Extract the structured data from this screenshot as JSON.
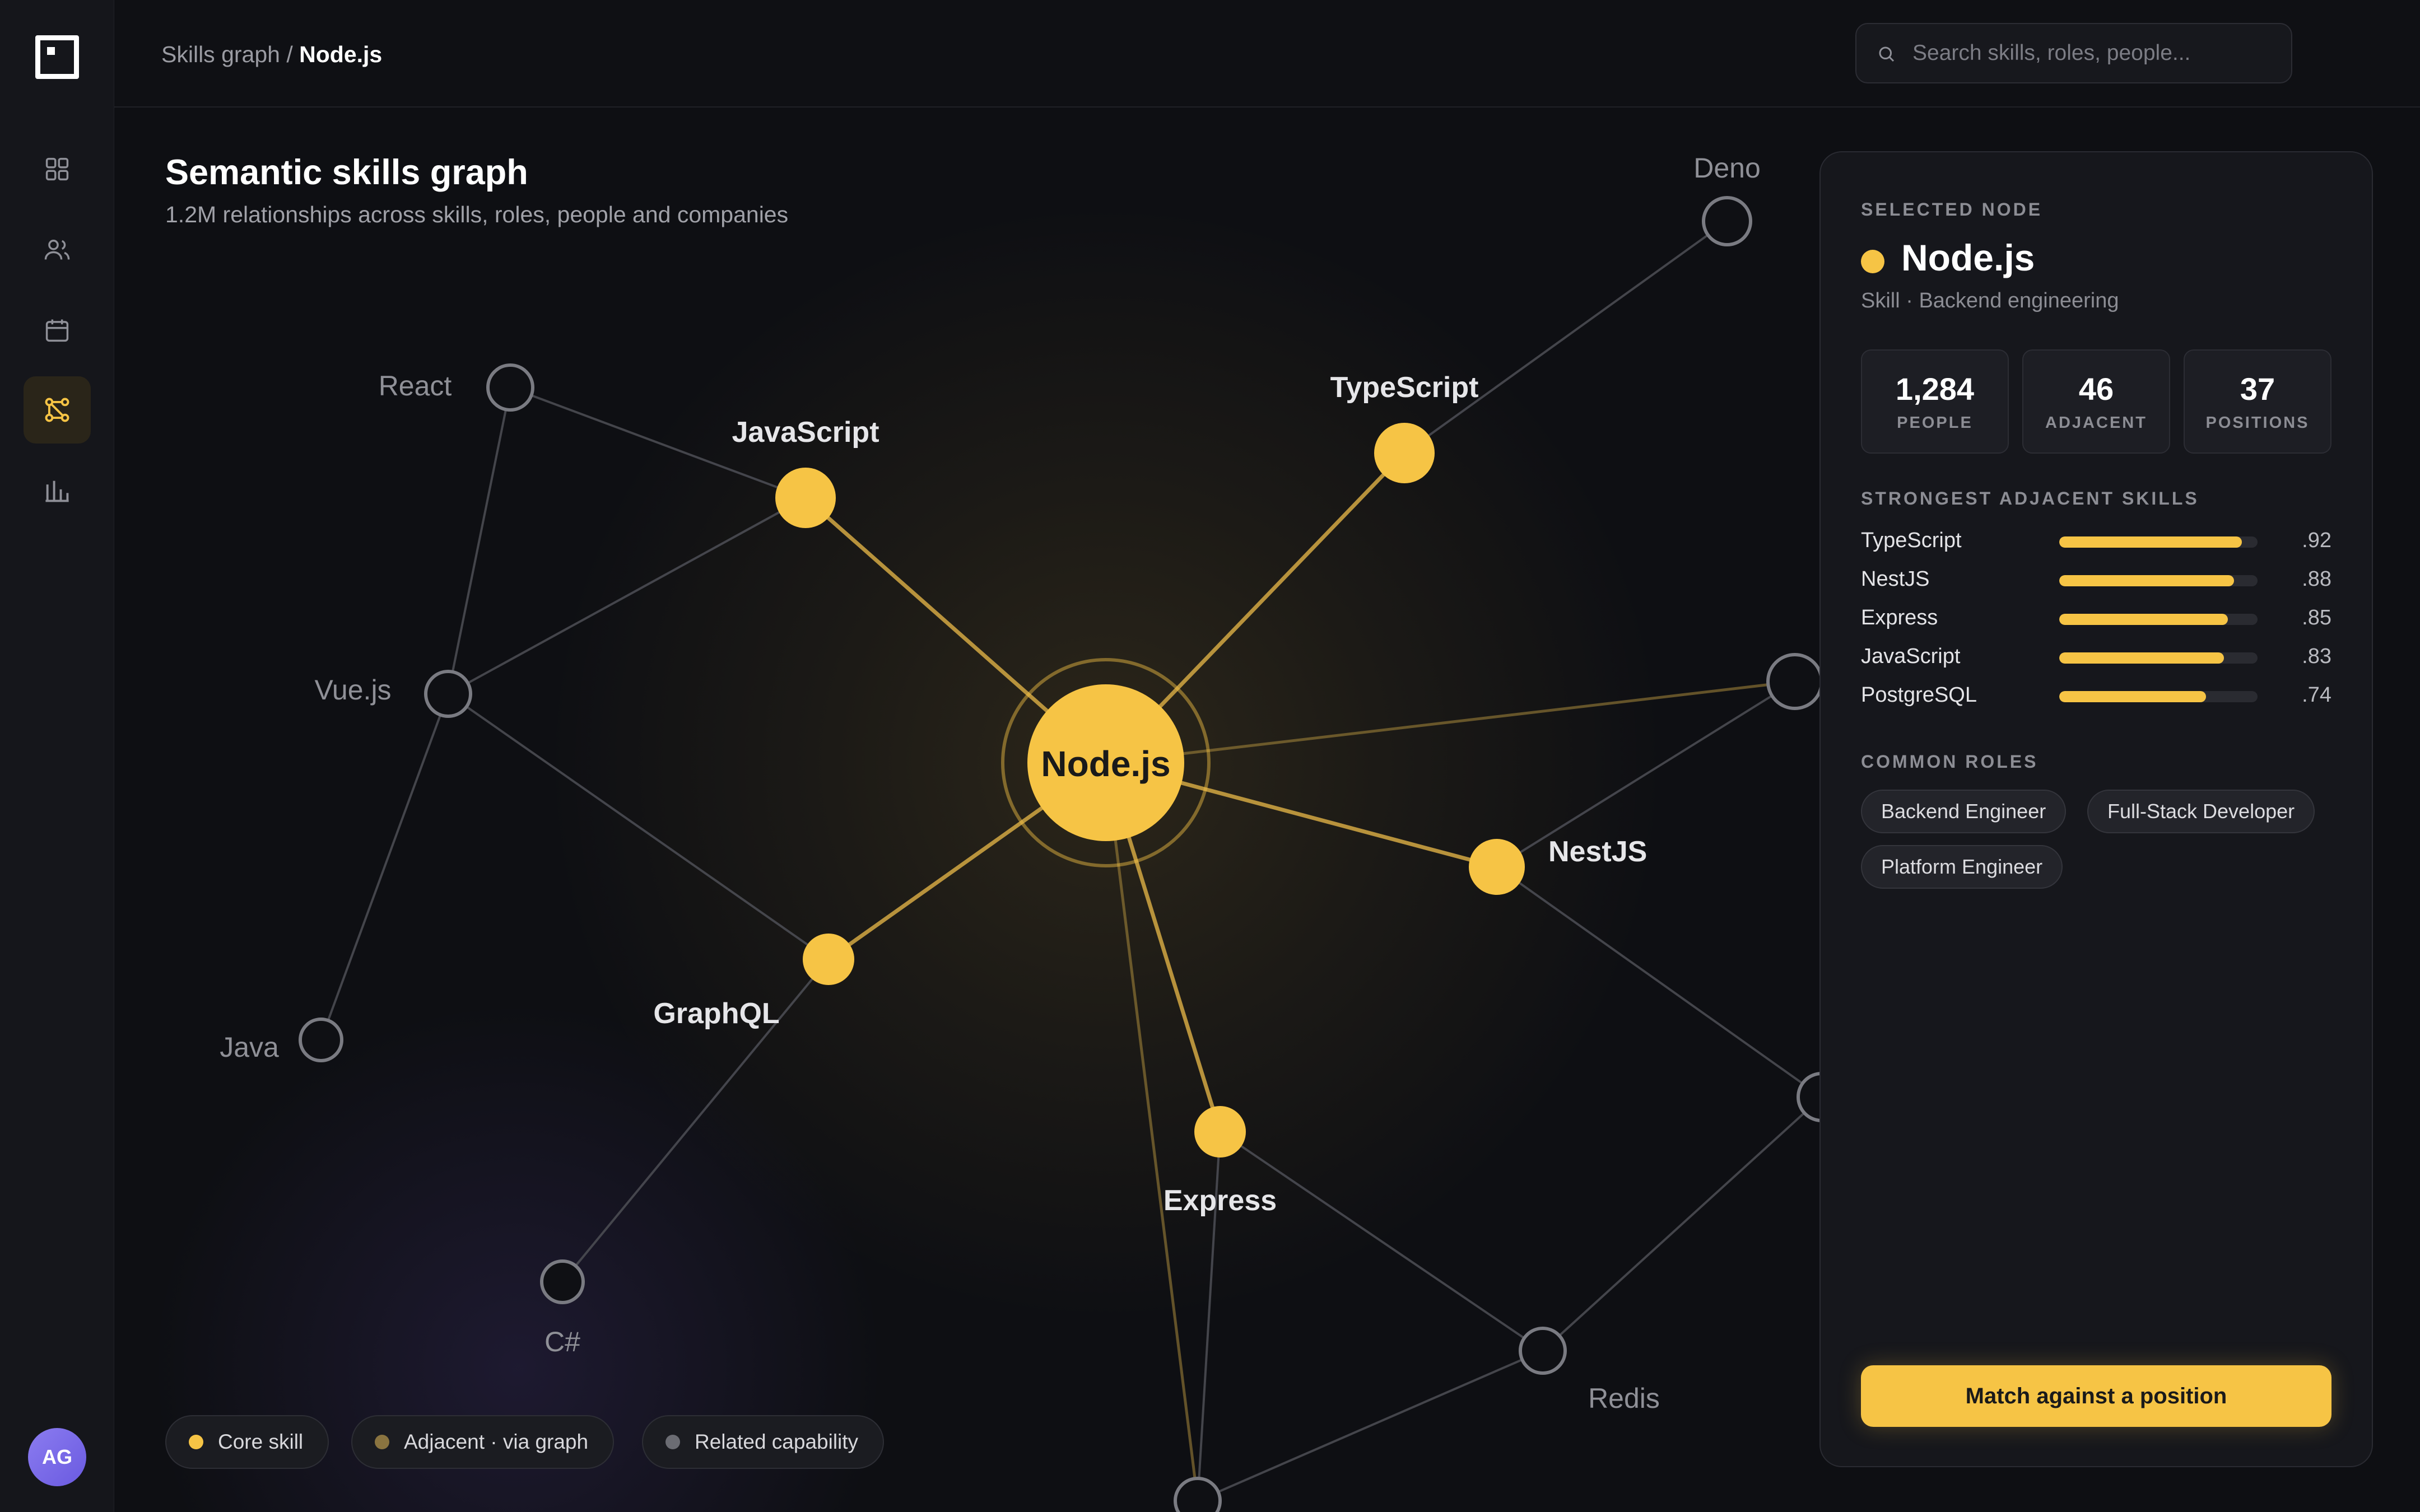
{
  "app": {
    "avatar_initials": "AG"
  },
  "breadcrumb": {
    "parent": "Skills graph",
    "separator": " / ",
    "current": "Node.js"
  },
  "search": {
    "placeholder": "Search skills, roles, people..."
  },
  "nav": {
    "items": [
      {
        "id": "dashboard",
        "icon": "grid-icon",
        "active": false
      },
      {
        "id": "people",
        "icon": "users-icon",
        "active": false
      },
      {
        "id": "calendar",
        "icon": "calendar-icon",
        "active": false
      },
      {
        "id": "graph",
        "icon": "graph-icon",
        "active": true
      },
      {
        "id": "analytics",
        "icon": "bar-chart-icon",
        "active": false
      }
    ]
  },
  "graph": {
    "title": "Semantic skills graph",
    "subtitle": "1.2M relationships across skills, roles, people and companies",
    "center": "Node.js",
    "nodes": [
      {
        "id": "Node.js",
        "label": "Node.js",
        "kind": "center"
      },
      {
        "id": "JavaScript",
        "label": "JavaScript",
        "kind": "core"
      },
      {
        "id": "TypeScript",
        "label": "TypeScript",
        "kind": "core"
      },
      {
        "id": "NestJS",
        "label": "NestJS",
        "kind": "core"
      },
      {
        "id": "GraphQL",
        "label": "GraphQL",
        "kind": "core"
      },
      {
        "id": "Express",
        "label": "Express",
        "kind": "core"
      },
      {
        "id": "React",
        "label": "React",
        "kind": "related"
      },
      {
        "id": "Vue.js",
        "label": "Vue.js",
        "kind": "related"
      },
      {
        "id": "Java",
        "label": "Java",
        "kind": "related"
      },
      {
        "id": "C#",
        "label": "C#",
        "kind": "related"
      },
      {
        "id": "Deno",
        "label": "Deno",
        "kind": "related"
      },
      {
        "id": "Redis",
        "label": "Redis",
        "kind": "related"
      },
      {
        "id": "hidden-right-1",
        "label": "",
        "kind": "related"
      },
      {
        "id": "hidden-right-2",
        "label": "",
        "kind": "related"
      },
      {
        "id": "hidden-bottom",
        "label": "",
        "kind": "related"
      }
    ],
    "edges": [
      [
        "Node.js",
        "JavaScript",
        "strong"
      ],
      [
        "Node.js",
        "TypeScript",
        "strong"
      ],
      [
        "Node.js",
        "NestJS",
        "strong"
      ],
      [
        "Node.js",
        "GraphQL",
        "strong"
      ],
      [
        "Node.js",
        "Express",
        "strong"
      ],
      [
        "Node.js",
        "hidden-right-1",
        "faint-gold"
      ],
      [
        "Node.js",
        "hidden-bottom",
        "faint-gold"
      ],
      [
        "React",
        "JavaScript",
        "gray"
      ],
      [
        "React",
        "Vue.js",
        "gray"
      ],
      [
        "Vue.js",
        "JavaScript",
        "gray"
      ],
      [
        "Vue.js",
        "GraphQL",
        "gray"
      ],
      [
        "Vue.js",
        "Java",
        "gray"
      ],
      [
        "GraphQL",
        "C#",
        "gray"
      ],
      [
        "TypeScript",
        "Deno",
        "gray"
      ],
      [
        "NestJS",
        "hidden-right-1",
        "gray"
      ],
      [
        "NestJS",
        "hidden-right-2",
        "gray"
      ],
      [
        "Express",
        "Redis",
        "gray"
      ],
      [
        "Express",
        "hidden-bottom",
        "gray"
      ],
      [
        "Redis",
        "hidden-right-2",
        "gray"
      ],
      [
        "Redis",
        "hidden-bottom",
        "gray"
      ]
    ]
  },
  "legend": [
    {
      "label": "Core skill",
      "color": "#f6c445"
    },
    {
      "label": "Adjacent · via graph",
      "color": "#8a7440"
    },
    {
      "label": "Related capability",
      "color": "#6b6c73"
    }
  ],
  "panel": {
    "eyebrow": "SELECTED NODE",
    "node_name": "Node.js",
    "node_meta": "Skill · Backend engineering",
    "stats": [
      {
        "value": "1,284",
        "label": "PEOPLE"
      },
      {
        "value": "46",
        "label": "ADJACENT"
      },
      {
        "value": "37",
        "label": "POSITIONS"
      }
    ],
    "skills_heading": "STRONGEST ADJACENT SKILLS",
    "skills": [
      {
        "name": "TypeScript",
        "score": ".92",
        "value": 0.92
      },
      {
        "name": "NestJS",
        "score": ".88",
        "value": 0.88
      },
      {
        "name": "Express",
        "score": ".85",
        "value": 0.85
      },
      {
        "name": "JavaScript",
        "score": ".83",
        "value": 0.83
      },
      {
        "name": "PostgreSQL",
        "score": ".74",
        "value": 0.74
      }
    ],
    "roles_heading": "COMMON ROLES",
    "roles": [
      "Backend Engineer",
      "Full-Stack Developer",
      "Platform Engineer"
    ],
    "cta": "Match against a position"
  },
  "colors": {
    "accent": "#f6c445",
    "background": "#0e0f13",
    "panel": "#16171c"
  }
}
